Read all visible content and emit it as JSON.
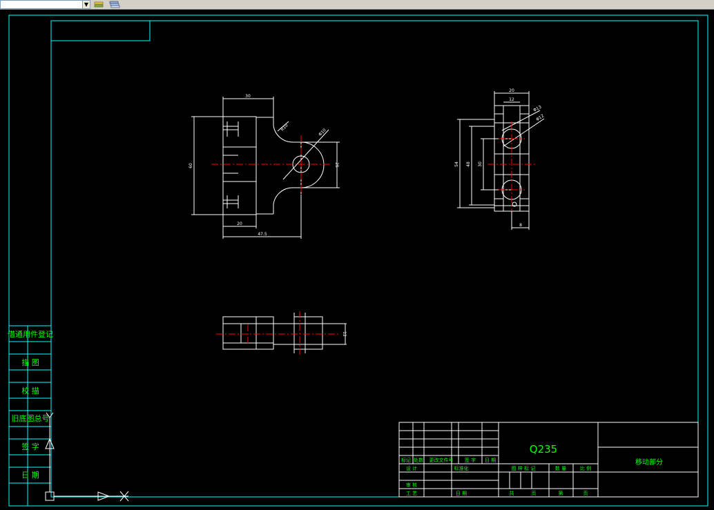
{
  "toolbar": {
    "combo_value": "",
    "arrow": "▼",
    "button_icons": [
      "layers-icon",
      "layer-properties-icon"
    ]
  },
  "colors": {
    "background": "#000000",
    "frame": "#00ffff",
    "outline": "#ffffff",
    "centerline": "#ff0000",
    "text": "#00ff00"
  },
  "side_labels": [
    "借通用件登记",
    "描  图",
    "校  描",
    "旧底图总号",
    "签  字",
    "日  期"
  ],
  "title_block": {
    "material": "Q235",
    "part_name": "移动部分",
    "rev_headers": [
      "标记",
      "处数",
      "更改文件号",
      "签  字",
      "日 期"
    ],
    "design": "设 计",
    "standardize": "标准化",
    "review": "审 核",
    "process": "工 艺",
    "date": "日 期",
    "stage_mark": "图 样 标 记",
    "quantity": "数 量",
    "scale": "比 例",
    "total": "共",
    "page": "页",
    "sheet_no": "第",
    "page2": "页"
  },
  "dimensions": {
    "front_top": "30",
    "front_left": "60",
    "front_bottom_short": "20",
    "front_bottom_long": "47.5",
    "front_right": "25",
    "front_r": "R10",
    "front_dia": "Φ10",
    "side_top": "20",
    "side_top_inner": "12",
    "side_dia1": "Φ13",
    "side_dia2": "Φ12",
    "side_h1": "54",
    "side_h2": "48",
    "side_h3": "30",
    "side_bottom": "8",
    "plan_right": "12"
  }
}
